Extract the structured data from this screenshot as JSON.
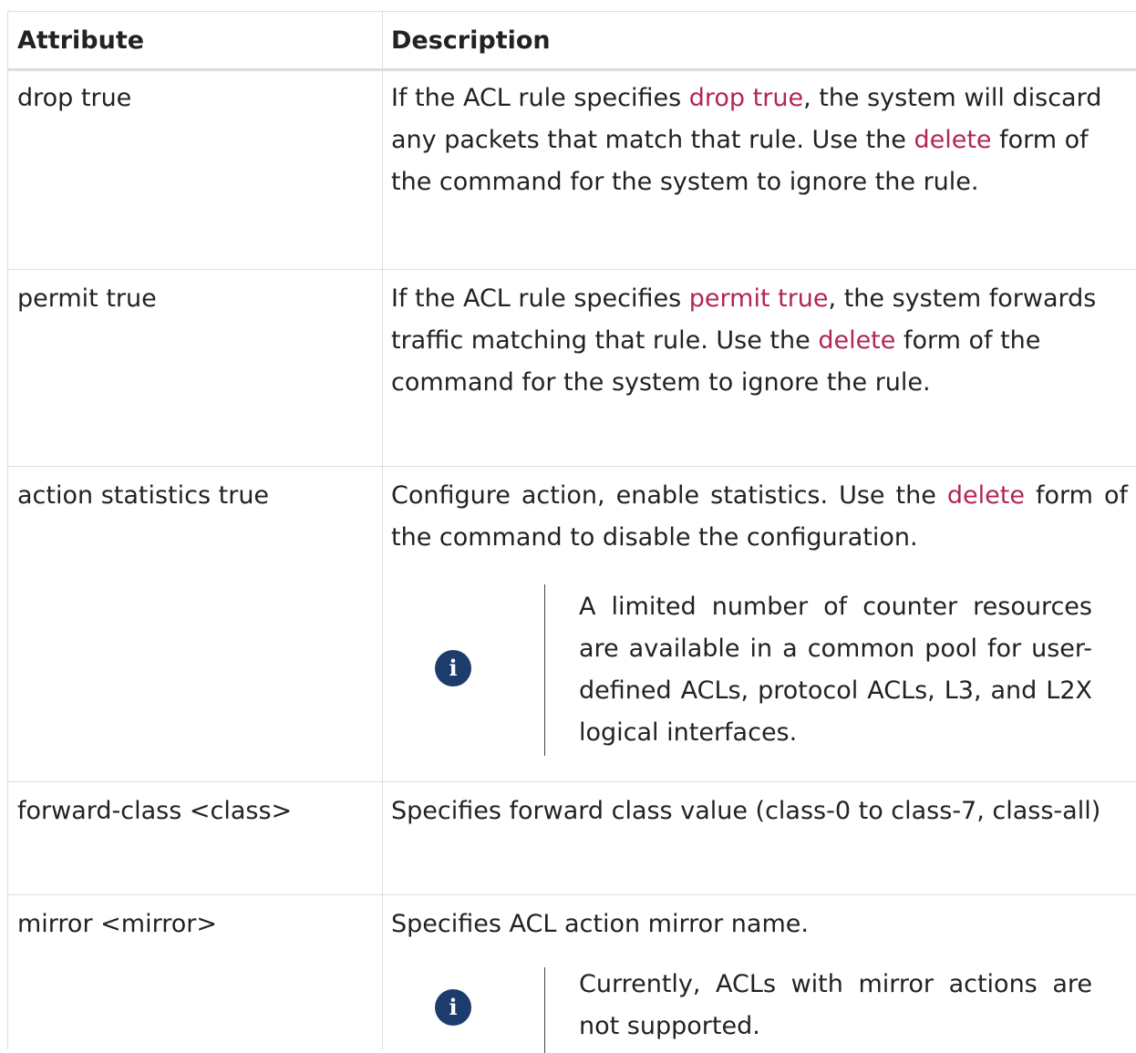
{
  "header": {
    "col1": "Attribute",
    "col2": "Description"
  },
  "rows": [
    {
      "attribute": "drop true",
      "desc": [
        "If the ACL rule specifies ",
        "drop true",
        ", the system will discard any packets that match that rule. Use the ",
        "delete",
        " form of the command for the system to ignore the rule."
      ]
    },
    {
      "attribute": "permit true",
      "desc": [
        "If the ACL rule specifies ",
        "permit true",
        ", the system forwards traffic matching that rule. Use the ",
        "delete",
        " form of the command for the system to ignore the rule."
      ]
    },
    {
      "attribute": "action statistics true",
      "desc": [
        "Configure action, enable statistics. Use the ",
        "delete",
        " form of the command to disable the configuration."
      ],
      "note": "A limited number of counter resources are available in a common pool for user-defined ACLs, protocol ACLs, L3, and L2X logical interfaces."
    },
    {
      "attribute": "forward-class <class>",
      "desc": "Specifies forward class value (class-0 to class-7, class-all)"
    },
    {
      "attribute": "mirror <mirror>",
      "desc": "Specifies ACL action mirror name.",
      "note": "Currently, ACLs with mirror actions are not supported."
    }
  ],
  "note_icon": {
    "name": "info-icon",
    "glyph": "i",
    "color": "#1d3c6e"
  },
  "colors": {
    "code": "#b3264f",
    "border": "#dddddd"
  }
}
